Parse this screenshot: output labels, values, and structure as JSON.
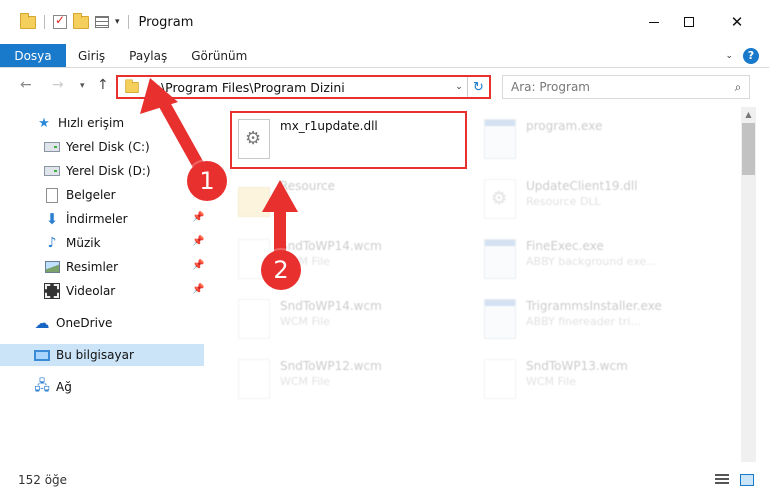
{
  "window": {
    "title": "Program"
  },
  "ribbon": {
    "file_tab": "Dosya",
    "tabs": [
      "Giriş",
      "Paylaş",
      "Görünüm"
    ]
  },
  "nav": {
    "address": "C:\\Program Files\\Program Dizini",
    "search_placeholder": "Ara: Program"
  },
  "sidebar": {
    "items": [
      {
        "label": "Hızlı erişim",
        "icon": "star-icon"
      },
      {
        "label": "Yerel Disk (C:)",
        "icon": "drive-icon"
      },
      {
        "label": "Yerel Disk (D:)",
        "icon": "drive-icon"
      },
      {
        "label": "Belgeler",
        "icon": "documents-icon"
      },
      {
        "label": "İndirmeler",
        "icon": "downloads-icon"
      },
      {
        "label": "Müzik",
        "icon": "music-icon"
      },
      {
        "label": "Resimler",
        "icon": "pictures-icon"
      },
      {
        "label": "Videolar",
        "icon": "videos-icon"
      },
      {
        "label": "OneDrive",
        "icon": "cloud-icon"
      },
      {
        "label": "Bu bilgisayar",
        "icon": "computer-icon"
      },
      {
        "label": "Ağ",
        "icon": "network-icon"
      }
    ]
  },
  "files": [
    {
      "name": "mx_r1update.dll",
      "type": ""
    },
    {
      "name": "program.exe",
      "type": ""
    },
    {
      "name": "Resource",
      "type": ""
    },
    {
      "name": "UpdateClient19.dll",
      "type": "Resource DLL"
    },
    {
      "name": "SndToWP14.wcm",
      "type": "WCM File"
    },
    {
      "name": "FineExec.exe",
      "type": "ABBY background exe..."
    },
    {
      "name": "SndToWP14.wcm",
      "type": "WCM File"
    },
    {
      "name": "TrigrammsInstaller.exe",
      "type": "ABBY finereader tri..."
    },
    {
      "name": "SndToWP12.wcm",
      "type": "WCM File"
    },
    {
      "name": "SndToWP13.wcm",
      "type": "WCM File"
    }
  ],
  "status": {
    "count": "152 öğe"
  },
  "annotations": {
    "step1": "1",
    "step2": "2",
    "color": "#e8312f"
  }
}
